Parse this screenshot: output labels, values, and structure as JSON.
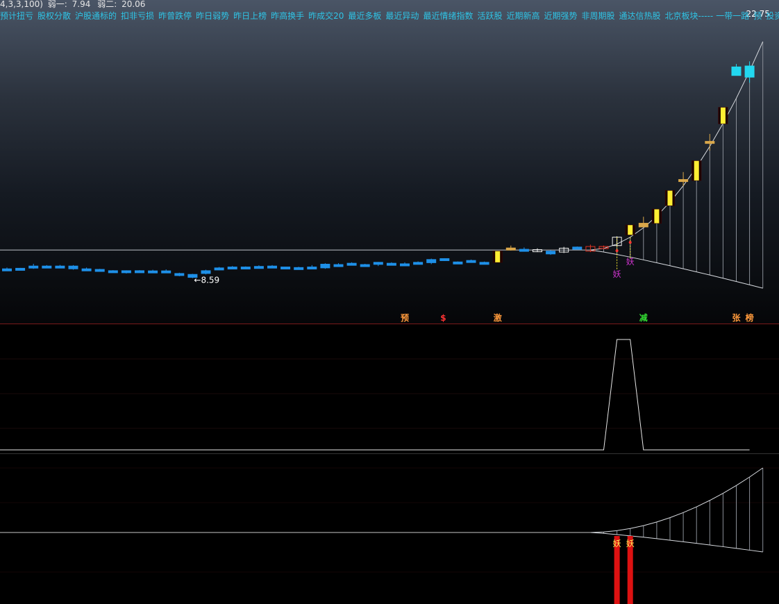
{
  "header": {
    "indicator_params": "4,3,3,100)",
    "line1_label": "弱一:",
    "line1_value": "7.94",
    "line2_label": "弱二:",
    "line2_value": "20.06"
  },
  "tag_bar": {
    "tags": [
      "预计扭亏",
      "股权分散",
      "沪股通标的",
      "扣非亏损",
      "昨曾跌停",
      "昨日弱势",
      "昨日上榜",
      "昨高换手",
      "昨成交20",
      "最近多板",
      "最近异动",
      "最近情绪指数",
      "活跃股",
      "近期新高",
      "近期强势",
      "非周期股",
      "通达信热股",
      "北京板块",
      "一带一路",
      "预",
      "投资"
    ],
    "color": "#2fc4e6",
    "dash_text": "-----"
  },
  "main_chart": {
    "max_label": "22.75",
    "min_label": "8.59",
    "min_arrow": "←",
    "price_range": [
      8.0,
      23.0
    ],
    "signal_labels": [
      {
        "text": "预",
        "index": 30,
        "color": "#ff9a3c"
      },
      {
        "text": "$",
        "index": 33,
        "color": "#ff3333"
      },
      {
        "text": "激",
        "index": 37,
        "color": "#ff9a3c"
      },
      {
        "text": "减",
        "index": 48,
        "color": "#33dd33"
      },
      {
        "text": "张",
        "index": 55,
        "color": "#ff9a3c"
      },
      {
        "text": "榜",
        "index": 56,
        "color": "#ff9a3c"
      }
    ],
    "yao_labels": [
      {
        "text": "妖",
        "index": 46,
        "color": "#cc33cc"
      },
      {
        "text": "妖",
        "index": 47,
        "color": "#cc33cc"
      }
    ]
  },
  "chart_data": {
    "type": "candlestick",
    "title": "",
    "ylabel": "",
    "candles": [
      {
        "o": 9.05,
        "h": 9.12,
        "l": 8.95,
        "c": 9.0,
        "color": "blue"
      },
      {
        "o": 9.05,
        "h": 9.1,
        "l": 8.98,
        "c": 9.08,
        "color": "blue"
      },
      {
        "o": 9.2,
        "h": 9.32,
        "l": 9.05,
        "c": 9.1,
        "color": "blue"
      },
      {
        "o": 9.2,
        "h": 9.25,
        "l": 9.13,
        "c": 9.17,
        "color": "blue"
      },
      {
        "o": 9.2,
        "h": 9.26,
        "l": 9.1,
        "c": 9.15,
        "color": "blue"
      },
      {
        "o": 9.2,
        "h": 9.25,
        "l": 9.0,
        "c": 9.05,
        "color": "blue"
      },
      {
        "o": 9.05,
        "h": 9.12,
        "l": 8.98,
        "c": 9.0,
        "color": "blue"
      },
      {
        "o": 9.02,
        "h": 9.05,
        "l": 8.95,
        "c": 9.0,
        "color": "blue"
      },
      {
        "o": 8.95,
        "h": 8.98,
        "l": 8.88,
        "c": 8.9,
        "color": "blue"
      },
      {
        "o": 8.95,
        "h": 8.97,
        "l": 8.8,
        "c": 8.85,
        "color": "blue"
      },
      {
        "o": 8.95,
        "h": 8.98,
        "l": 8.9,
        "c": 8.93,
        "color": "blue"
      },
      {
        "o": 8.94,
        "h": 9.0,
        "l": 8.86,
        "c": 8.9,
        "color": "blue"
      },
      {
        "o": 8.94,
        "h": 9.02,
        "l": 8.86,
        "c": 8.88,
        "color": "blue"
      },
      {
        "o": 8.8,
        "h": 8.84,
        "l": 8.65,
        "c": 8.7,
        "color": "blue"
      },
      {
        "o": 8.75,
        "h": 8.78,
        "l": 8.55,
        "c": 8.59,
        "color": "blue"
      },
      {
        "o": 8.8,
        "h": 9.0,
        "l": 8.75,
        "c": 8.95,
        "color": "blue"
      },
      {
        "o": 9.05,
        "h": 9.15,
        "l": 8.98,
        "c": 9.1,
        "color": "blue"
      },
      {
        "o": 9.15,
        "h": 9.2,
        "l": 9.05,
        "c": 9.1,
        "color": "blue"
      },
      {
        "o": 9.15,
        "h": 9.18,
        "l": 9.1,
        "c": 9.13,
        "color": "blue"
      },
      {
        "o": 9.18,
        "h": 9.24,
        "l": 9.12,
        "c": 9.15,
        "color": "blue"
      },
      {
        "o": 9.2,
        "h": 9.25,
        "l": 9.14,
        "c": 9.17,
        "color": "blue"
      },
      {
        "o": 9.15,
        "h": 9.16,
        "l": 9.05,
        "c": 9.07,
        "color": "blue"
      },
      {
        "o": 9.12,
        "h": 9.16,
        "l": 9.04,
        "c": 9.06,
        "color": "blue"
      },
      {
        "o": 9.12,
        "h": 9.25,
        "l": 9.05,
        "c": 9.15,
        "color": "blue"
      },
      {
        "o": 9.3,
        "h": 9.35,
        "l": 9.05,
        "c": 9.1,
        "color": "blue"
      },
      {
        "o": 9.28,
        "h": 9.35,
        "l": 9.22,
        "c": 9.25,
        "color": "blue"
      },
      {
        "o": 9.35,
        "h": 9.4,
        "l": 9.25,
        "c": 9.28,
        "color": "blue"
      },
      {
        "o": 9.28,
        "h": 9.32,
        "l": 9.2,
        "c": 9.25,
        "color": "blue"
      },
      {
        "o": 9.4,
        "h": 9.42,
        "l": 9.2,
        "c": 9.3,
        "color": "blue"
      },
      {
        "o": 9.35,
        "h": 9.4,
        "l": 9.28,
        "c": 9.33,
        "color": "blue"
      },
      {
        "o": 9.32,
        "h": 9.4,
        "l": 9.23,
        "c": 9.28,
        "color": "blue"
      },
      {
        "o": 9.37,
        "h": 9.45,
        "l": 9.3,
        "c": 9.4,
        "color": "blue"
      },
      {
        "o": 9.55,
        "h": 9.6,
        "l": 9.3,
        "c": 9.38,
        "color": "blue"
      },
      {
        "o": 9.6,
        "h": 9.62,
        "l": 9.47,
        "c": 9.5,
        "color": "blue"
      },
      {
        "o": 9.4,
        "h": 9.45,
        "l": 9.37,
        "c": 9.42,
        "color": "blue"
      },
      {
        "o": 9.5,
        "h": 9.55,
        "l": 9.4,
        "c": 9.45,
        "color": "blue"
      },
      {
        "o": 9.4,
        "h": 9.44,
        "l": 9.35,
        "c": 9.38,
        "color": "blue"
      },
      {
        "o": 9.4,
        "h": 10.0,
        "l": 9.4,
        "c": 10.0,
        "color": "yellow"
      },
      {
        "o": 10.1,
        "h": 10.3,
        "l": 10.03,
        "c": 10.17,
        "color": "tan"
      },
      {
        "o": 10.1,
        "h": 10.2,
        "l": 10.02,
        "c": 10.06,
        "color": "blue"
      },
      {
        "o": 10.02,
        "h": 10.15,
        "l": 9.95,
        "c": 10.08,
        "color": "outline"
      },
      {
        "o": 10.0,
        "h": 10.05,
        "l": 9.8,
        "c": 9.85,
        "color": "blue"
      },
      {
        "o": 9.95,
        "h": 10.23,
        "l": 9.9,
        "c": 10.16,
        "color": "outline"
      },
      {
        "o": 10.22,
        "h": 10.25,
        "l": 10.08,
        "c": 10.1,
        "color": "blue"
      },
      {
        "o": 10.25,
        "h": 10.35,
        "l": 9.95,
        "c": 10.0,
        "color": "darkred"
      },
      {
        "o": 10.25,
        "h": 10.3,
        "l": 10.18,
        "c": 10.2,
        "color": "red"
      },
      {
        "o": 10.3,
        "h": 10.8,
        "l": 10.25,
        "c": 10.75,
        "color": "outline"
      },
      {
        "o": 10.88,
        "h": 11.4,
        "l": 10.88,
        "c": 11.4,
        "color": "yellow"
      },
      {
        "o": 11.3,
        "h": 11.85,
        "l": 11.35,
        "c": 11.5,
        "color": "tan"
      },
      {
        "o": 11.5,
        "h": 12.25,
        "l": 11.5,
        "c": 12.25,
        "color": "yellow"
      },
      {
        "o": 12.45,
        "h": 13.25,
        "l": 12.45,
        "c": 13.25,
        "color": "yellow"
      },
      {
        "o": 13.85,
        "h": 14.25,
        "l": 13.5,
        "c": 13.8,
        "color": "tan"
      },
      {
        "o": 13.8,
        "h": 14.85,
        "l": 13.8,
        "c": 14.85,
        "color": "yellow"
      },
      {
        "o": 15.9,
        "h": 16.3,
        "l": 15.4,
        "c": 15.87,
        "color": "tan"
      },
      {
        "o": 16.85,
        "h": 17.72,
        "l": 16.85,
        "c": 17.72,
        "color": "yellow"
      },
      {
        "o": 19.9,
        "h": 20.06,
        "l": 19.43,
        "c": 19.44,
        "color": "cyan-blue"
      },
      {
        "o": 19.95,
        "h": 20.2,
        "l": 19.05,
        "c": 19.35,
        "color": "cyan"
      }
    ],
    "resistance_level": 10.06,
    "max_price": 22.75,
    "min_price": 8.59
  },
  "mid_indicator": {
    "levels": [
      0,
      1
    ],
    "values": [
      0,
      0,
      0,
      0,
      0,
      0,
      0,
      0,
      0,
      0,
      0,
      0,
      0,
      0,
      0,
      0,
      0,
      0,
      0,
      0,
      0,
      0,
      0,
      0,
      0,
      0,
      0,
      0,
      0,
      0,
      0,
      0,
      0,
      0,
      0,
      0,
      0,
      0,
      0,
      0,
      0,
      0,
      0,
      0,
      0,
      0,
      1,
      1,
      0,
      0,
      0,
      0,
      0,
      0,
      0,
      0,
      0
    ]
  },
  "low_indicator": {
    "bar_labels": [
      {
        "text": "妖",
        "index": 46
      },
      {
        "text": "妖",
        "index": 47
      }
    ],
    "bar_color": "#dd1111",
    "label_color": "#ffee55"
  }
}
